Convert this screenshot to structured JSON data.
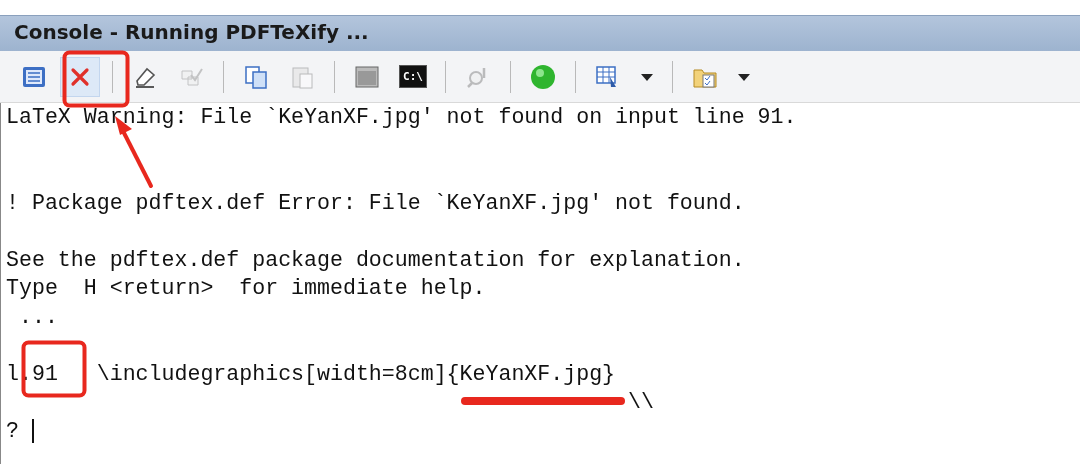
{
  "window": {
    "title": "Console - Running PDFTeXify ..."
  },
  "toolbar": [
    {
      "kind": "list",
      "disabled": false,
      "hot": false
    },
    {
      "kind": "stop",
      "disabled": false,
      "hot": true
    },
    {
      "kind": "separator"
    },
    {
      "kind": "eraser",
      "disabled": false,
      "hot": false
    },
    {
      "kind": "check",
      "disabled": true,
      "hot": false
    },
    {
      "kind": "separator"
    },
    {
      "kind": "copy",
      "disabled": false,
      "hot": false
    },
    {
      "kind": "paste",
      "disabled": true,
      "hot": false
    },
    {
      "kind": "separator"
    },
    {
      "kind": "window",
      "disabled": false,
      "hot": false
    },
    {
      "kind": "terminal",
      "disabled": false,
      "hot": false,
      "label": "C:\\"
    },
    {
      "kind": "separator"
    },
    {
      "kind": "find",
      "disabled": true,
      "hot": false
    },
    {
      "kind": "separator"
    },
    {
      "kind": "go",
      "disabled": false,
      "hot": false
    },
    {
      "kind": "separator"
    },
    {
      "kind": "table",
      "disabled": false,
      "hot": false,
      "dropdown": true
    },
    {
      "kind": "separator"
    },
    {
      "kind": "folder",
      "disabled": false,
      "hot": false,
      "dropdown": true
    }
  ],
  "console": {
    "paragraphs": [
      [
        "LaTeX Warning: File `KeYanXF.jpg' not found on input line 91."
      ],
      [
        "! Package pdftex.def Error: File `KeYanXF.jpg' not found."
      ],
      [
        "See the pdftex.def package documentation for explanation.",
        "Type  H <return>  for immediate help.",
        " ..."
      ],
      [
        "l.91   \\includegraphics[width=8cm]{KeYanXF.jpg}",
        {
          "kind": "continuation",
          "text": "\\\\"
        },
        "? "
      ]
    ],
    "cursor": true
  }
}
